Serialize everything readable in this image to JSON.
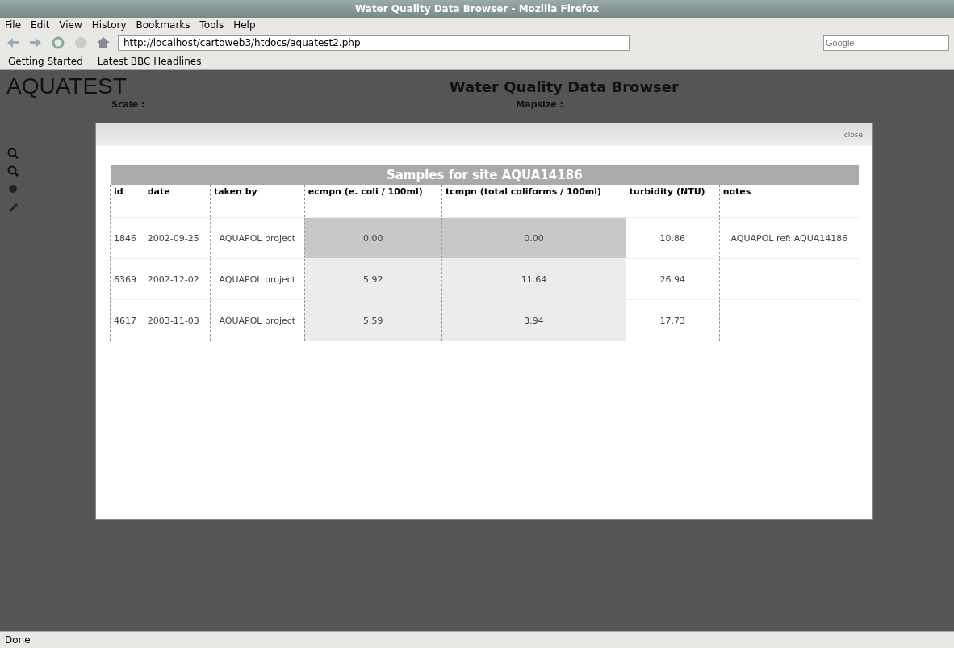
{
  "window": {
    "title": "Water Quality Data Browser - Mozilla Firefox"
  },
  "menu": [
    "File",
    "Edit",
    "View",
    "History",
    "Bookmarks",
    "Tools",
    "Help"
  ],
  "address_bar": {
    "value": "http://localhost/cartoweb3/htdocs/aquatest2.php"
  },
  "search": {
    "placeholder": "Google"
  },
  "bookmarks": [
    "Getting Started",
    "Latest BBC Headlines"
  ],
  "page": {
    "logo": "AQUATEST",
    "heading": "Water Quality Data Browser",
    "scale_label": "Scale :",
    "mapsize_label": "Mapsize :"
  },
  "dialog": {
    "close": "close",
    "table": {
      "caption": "Samples for site AQUA14186",
      "columns": [
        "id",
        "date",
        "taken by",
        "ecmpn (e. coli / 100ml)",
        "tcmpn (total coliforms / 100ml)",
        "turbidity (NTU)",
        "notes"
      ],
      "rows": [
        {
          "highlighted": true,
          "cells": [
            "1846",
            "2002-09-25",
            "AQUAPOL project",
            "0.00",
            "0.00",
            "10.86",
            "AQUAPOL ref: AQUA14186"
          ]
        },
        {
          "highlighted": false,
          "cells": [
            "6369",
            "2002-12-02",
            "AQUAPOL project",
            "5.92",
            "11.64",
            "26.94",
            ""
          ]
        },
        {
          "highlighted": false,
          "cells": [
            "4617",
            "2003-11-03",
            "AQUAPOL project",
            "5.59",
            "3.94",
            "17.73",
            ""
          ]
        }
      ]
    }
  },
  "status_bar": {
    "text": "Done"
  }
}
